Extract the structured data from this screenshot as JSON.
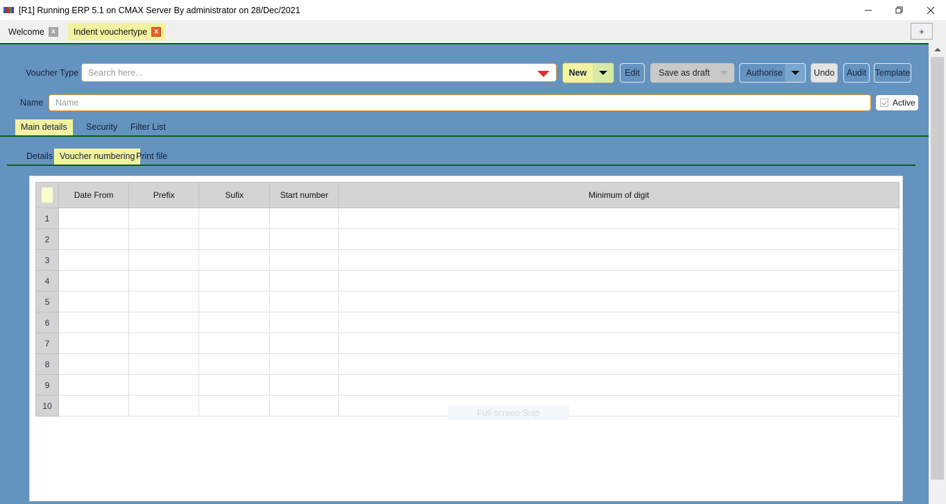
{
  "window": {
    "title": "[R1] Running ERP 5.1 on CMAX Server By administrator on 28/Dec/2021",
    "icon": "app-icon",
    "controls": {
      "minimize": "minimize-icon",
      "restore": "restore-icon",
      "close": "close-icon"
    }
  },
  "tabstrip": {
    "tabs": [
      {
        "label": "Welcome",
        "active": false,
        "close": "x"
      },
      {
        "label": "Indent vouchertype",
        "active": true,
        "close": "x"
      }
    ],
    "new_tab_label": "+"
  },
  "form": {
    "voucher_type_label": "Voucher Type",
    "search_placeholder": "Search here...",
    "search_value": "",
    "name_label": "Name",
    "name_placeholder": "Name",
    "name_value": "",
    "active_label": "Active",
    "active_checked": true
  },
  "toolbar": {
    "new_label": "New",
    "edit_label": "Edit",
    "save_as_draft_label": "Save as draft",
    "authorise_label": "Authorise",
    "undo_label": "Undo",
    "audit_label": "Audit",
    "template_label": "Template"
  },
  "main_tabs": [
    {
      "label": "Main details",
      "active": true
    },
    {
      "label": "Security",
      "active": false
    },
    {
      "label": "Filter List",
      "active": false
    }
  ],
  "sub_tabs": [
    {
      "label": "Details",
      "active": false
    },
    {
      "label": "Voucher numbering",
      "active": true
    },
    {
      "label": "Print file",
      "active": false
    }
  ],
  "grid": {
    "columns": [
      "",
      "Date From",
      "Prefix",
      "Sufix",
      "Start number",
      "Minimum of digit"
    ],
    "rows": [
      {
        "num": "1",
        "date_from": "",
        "prefix": "",
        "sufix": "",
        "start_number": "",
        "minimum_of_digit": ""
      },
      {
        "num": "2",
        "date_from": "",
        "prefix": "",
        "sufix": "",
        "start_number": "",
        "minimum_of_digit": ""
      },
      {
        "num": "3",
        "date_from": "",
        "prefix": "",
        "sufix": "",
        "start_number": "",
        "minimum_of_digit": ""
      },
      {
        "num": "4",
        "date_from": "",
        "prefix": "",
        "sufix": "",
        "start_number": "",
        "minimum_of_digit": ""
      },
      {
        "num": "5",
        "date_from": "",
        "prefix": "",
        "sufix": "",
        "start_number": "",
        "minimum_of_digit": ""
      },
      {
        "num": "6",
        "date_from": "",
        "prefix": "",
        "sufix": "",
        "start_number": "",
        "minimum_of_digit": ""
      },
      {
        "num": "7",
        "date_from": "",
        "prefix": "",
        "sufix": "",
        "start_number": "",
        "minimum_of_digit": ""
      },
      {
        "num": "8",
        "date_from": "",
        "prefix": "",
        "sufix": "",
        "start_number": "",
        "minimum_of_digit": ""
      },
      {
        "num": "9",
        "date_from": "",
        "prefix": "",
        "sufix": "",
        "start_number": "",
        "minimum_of_digit": ""
      },
      {
        "num": "10",
        "date_from": "",
        "prefix": "",
        "sufix": "",
        "start_number": "",
        "minimum_of_digit": ""
      }
    ]
  },
  "overlay": {
    "snip_label": "Full-screen Snip"
  },
  "colors": {
    "app_background": "#6593c0",
    "accent_yellow": "#f2f2a0",
    "separator_green": "#0a5f16",
    "field_border_orange": "#e59b28",
    "caret_red": "#e03030",
    "header_grey": "#d4d4d4"
  }
}
